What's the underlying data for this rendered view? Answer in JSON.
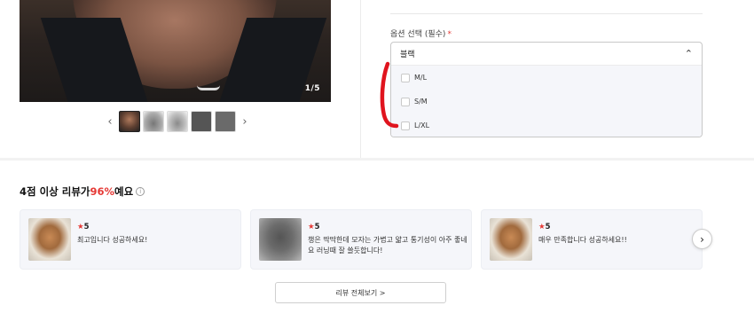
{
  "product": {
    "image_counter": "1/5",
    "thumbnails": [
      "thumb-1",
      "thumb-2",
      "thumb-3",
      "thumb-4",
      "thumb-5"
    ],
    "thumb_prev_icon": "chevron-left-icon",
    "thumb_next_icon": "chevron-right-icon"
  },
  "options": {
    "label": "옵션 선택 (필수)",
    "required_mark": "*",
    "selected": "블랙",
    "chevron": "chevron-up-icon",
    "items": [
      {
        "label": "M/L"
      },
      {
        "label": "S/M"
      },
      {
        "label": "L/XL"
      }
    ]
  },
  "reviews": {
    "heading_prefix": "4점 이상 리뷰가 ",
    "heading_pct": "96%",
    "heading_suffix": "예요",
    "info_icon": "i",
    "cards": [
      {
        "rating": "5",
        "text": "최고입니다 성공하세요!",
        "photo": "dog"
      },
      {
        "rating": "5",
        "text": "챙은 딱딱한데 모자는 가볍고 얇고 통기성이 아주 좋네요 러닝때 잘 쓸듯합니다!",
        "photo": "cap"
      },
      {
        "rating": "5",
        "text": "매우 만족합니다 성공하세요!!",
        "photo": "dog"
      }
    ],
    "next_icon": "chevron-right-icon",
    "view_all_label": "리뷰 전체보기 >"
  },
  "colors": {
    "accent_red": "#e53935",
    "card_bg": "#f5f6fa"
  }
}
